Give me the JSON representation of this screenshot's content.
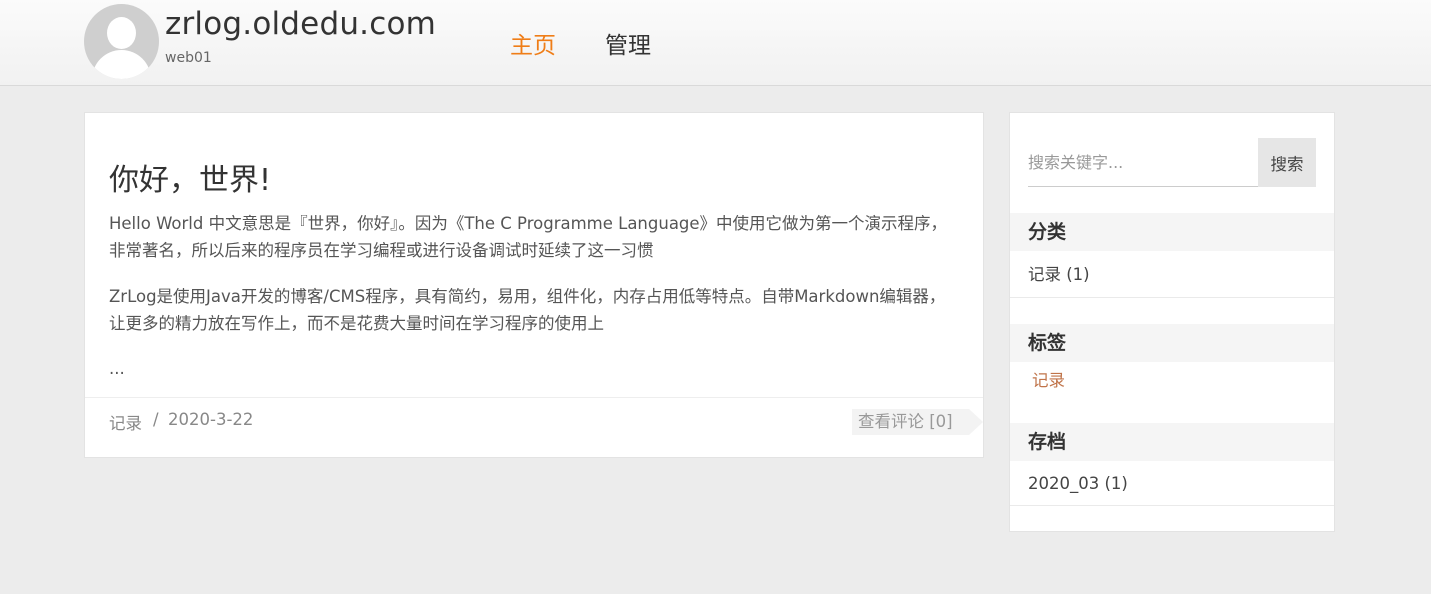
{
  "header": {
    "site_title": "zrlog.oldedu.com",
    "site_subtitle": "web01",
    "nav": {
      "home": "主页",
      "admin": "管理"
    },
    "active_color": "#ef7d17"
  },
  "post": {
    "title": "你好，世界!",
    "paragraph1": "Hello World 中文意思是『世界，你好』。因为《The C Programme Language》中使用它做为第一个演示程序，非常著名，所以后来的程序员在学习编程或进行设备调试时延续了这一习惯",
    "paragraph2": "ZrLog是使用Java开发的博客/CMS程序，具有简约，易用，组件化，内存占用低等特点。自带Markdown编辑器，让更多的精力放在写作上，而不是花费大量时间在学习程序的使用上",
    "ellipsis": "...",
    "category": "记录",
    "separator": "/",
    "date": "2020-3-22",
    "comments_label": "查看评论 [0]"
  },
  "sidebar": {
    "search": {
      "placeholder": "搜索关键字...",
      "button_label": "搜索"
    },
    "categories": {
      "heading": "分类",
      "items": [
        "记录 (1)"
      ]
    },
    "tags": {
      "heading": "标签",
      "items": [
        "记录"
      ]
    },
    "archives": {
      "heading": "存档",
      "items": [
        "2020_03 (1)"
      ]
    }
  }
}
